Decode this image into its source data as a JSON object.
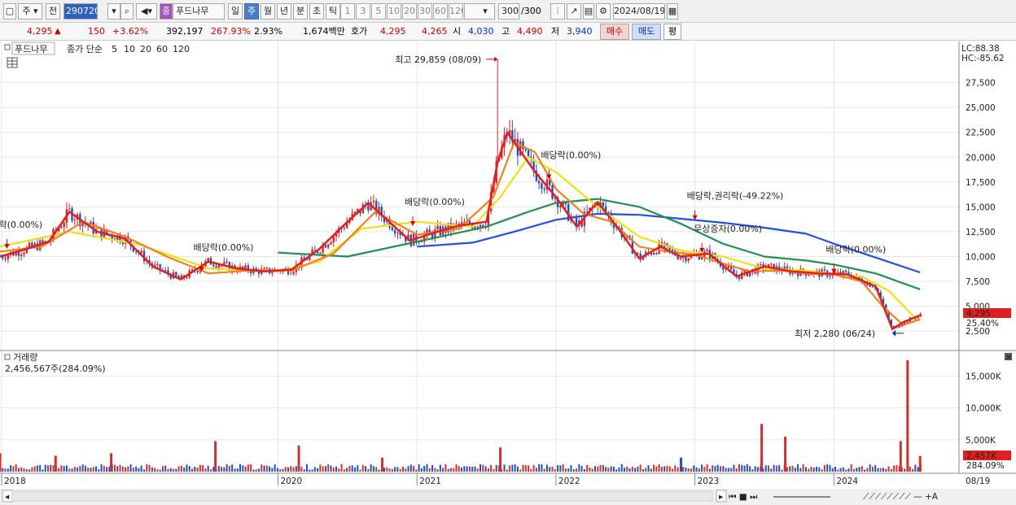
{
  "toolbar": {
    "period_type": "주",
    "prev_label": "전",
    "code_value": "290720",
    "name_badge": "종",
    "stock_name": "푸드나무",
    "period_tabs": [
      "일",
      "주",
      "월",
      "년",
      "분",
      "초",
      "틱"
    ],
    "selected_period": "주",
    "intervals": [
      "1",
      "3",
      "5",
      "10",
      "20",
      "30",
      "60",
      "120"
    ],
    "count": "300",
    "count_total": "/300",
    "date": "2024/08/19"
  },
  "quote": {
    "price": "4,295",
    "change_arrow": "▲",
    "change": "150",
    "change_pct": "+3.62%",
    "volume": "392,197",
    "volume_ratio": "267.93%",
    "turnover": "2.93%",
    "amount": "1,674백만",
    "ask_label": "호가",
    "ask": "4,295",
    "bid": "4,265",
    "open_label": "시",
    "open": "4,030",
    "high_label": "고",
    "high": "4,490",
    "low_label": "저",
    "low": "3,940",
    "buy_label": "매수",
    "sell_label": "매도",
    "eval_label": "평"
  },
  "legend": {
    "name": "푸드나무",
    "ma_label": "종가 단순",
    "periods": [
      "5",
      "10",
      "20",
      "60",
      "120"
    ],
    "colors": [
      "#e02020",
      "#f08020",
      "#f0e010",
      "#209050",
      "#2050e0"
    ]
  },
  "right_axis": {
    "lc": "LC:88.38",
    "hc": "HC:-85.62",
    "price_tag": "4,295",
    "pct_tag": "25.40%",
    "vol_tag": "2,457K",
    "vol_pct_tag": "284.09%"
  },
  "volume_panel": {
    "title": "거래량",
    "value": "2,456,567주(284.09%)"
  },
  "bottom": {
    "date_label": "08/19"
  },
  "chart_data": [
    {
      "type": "line",
      "ylim": [
        1200,
        30500
      ],
      "y_ticks": [
        2500,
        5000,
        7500,
        10000,
        12500,
        15000,
        17500,
        20000,
        22500,
        25000,
        27500
      ],
      "y_tick_labels": [
        "2,500",
        "5,000",
        "7,500",
        "10,000",
        "12,500",
        "15,000",
        "17,500",
        "20,000",
        "22,500",
        "25,000",
        "27,500"
      ],
      "x_ticks": [
        2018,
        2020,
        2021,
        2022,
        2023,
        2024
      ],
      "x_tick_labels": [
        "2018",
        "2020",
        "2021",
        "2022",
        "2023",
        "2024"
      ],
      "x_range": [
        2018.0,
        2024.9
      ],
      "series": [
        {
          "name": "5",
          "color": "#e02020",
          "x": [
            2018.0,
            2018.2,
            2018.35,
            2018.5,
            2018.7,
            2018.9,
            2019.1,
            2019.3,
            2019.5,
            2019.7,
            2019.9,
            2020.1,
            2020.3,
            2020.5,
            2020.65,
            2020.8,
            2020.95,
            2021.1,
            2021.3,
            2021.5,
            2021.58,
            2021.65,
            2021.75,
            2021.85,
            2022.0,
            2022.15,
            2022.3,
            2022.45,
            2022.6,
            2022.75,
            2022.9,
            2023.1,
            2023.3,
            2023.5,
            2023.7,
            2023.9,
            2024.1,
            2024.3,
            2024.42,
            2024.5,
            2024.62
          ],
          "y": [
            10000,
            10800,
            11500,
            14500,
            12500,
            11800,
            9000,
            7700,
            9500,
            8800,
            8500,
            8700,
            10800,
            13500,
            15400,
            13500,
            11600,
            12300,
            13100,
            13500,
            19500,
            22500,
            20500,
            18500,
            16000,
            13000,
            15500,
            12800,
            9800,
            11000,
            10000,
            10300,
            8000,
            9000,
            8500,
            8300,
            8200,
            7000,
            2700,
            3400,
            4100
          ]
        },
        {
          "name": "10",
          "color": "#f08020",
          "x": [
            2018.0,
            2018.3,
            2018.6,
            2018.9,
            2019.2,
            2019.5,
            2019.8,
            2020.1,
            2020.4,
            2020.7,
            2021.0,
            2021.3,
            2021.55,
            2021.7,
            2021.85,
            2022.0,
            2022.2,
            2022.4,
            2022.6,
            2022.8,
            2023.0,
            2023.2,
            2023.4,
            2023.6,
            2023.8,
            2024.0,
            2024.2,
            2024.35,
            2024.5,
            2024.62
          ],
          "y": [
            10500,
            11000,
            13500,
            12000,
            10000,
            8300,
            8600,
            8600,
            10300,
            14500,
            12200,
            12800,
            16000,
            21500,
            20500,
            16800,
            14300,
            13500,
            11000,
            10500,
            10200,
            9300,
            8500,
            8600,
            8300,
            8200,
            7500,
            5000,
            3100,
            3700
          ]
        },
        {
          "name": "20",
          "color": "#f0e010",
          "x": [
            2018.0,
            2018.5,
            2019.0,
            2019.5,
            2020.0,
            2020.3,
            2020.6,
            2021.0,
            2021.4,
            2021.6,
            2021.8,
            2022.0,
            2022.3,
            2022.6,
            2022.9,
            2023.2,
            2023.5,
            2023.8,
            2024.0,
            2024.2,
            2024.4,
            2024.55,
            2024.62
          ],
          "y": [
            11000,
            12500,
            11200,
            8800,
            8500,
            9500,
            12800,
            13500,
            13000,
            16000,
            20000,
            18500,
            15000,
            12000,
            10600,
            10000,
            8800,
            8600,
            8200,
            8000,
            6500,
            4300,
            3500
          ]
        },
        {
          "name": "60",
          "color": "#209050",
          "x": [
            2020.0,
            2020.5,
            2021.0,
            2021.5,
            2021.8,
            2022.0,
            2022.3,
            2022.6,
            2022.9,
            2023.2,
            2023.5,
            2023.8,
            2024.0,
            2024.3,
            2024.62
          ],
          "y": [
            10400,
            10000,
            11500,
            13000,
            14500,
            15400,
            15800,
            15000,
            13300,
            11300,
            10000,
            9600,
            9200,
            8300,
            6700
          ]
        },
        {
          "name": "120",
          "color": "#2050e0",
          "x": [
            2021.0,
            2021.4,
            2021.7,
            2022.0,
            2022.3,
            2022.6,
            2022.9,
            2023.2,
            2023.5,
            2023.8,
            2024.0,
            2024.3,
            2024.62
          ],
          "y": [
            11000,
            11400,
            12500,
            13700,
            14300,
            14200,
            13800,
            13400,
            12900,
            12300,
            11300,
            9900,
            8400
          ]
        }
      ],
      "annotations": [
        {
          "text": "최고 29,859 (08/09)",
          "x": 2021.58,
          "y": 29859,
          "color": "#d00000"
        },
        {
          "text": "최저 2,280 (06/24)",
          "x": 2024.42,
          "y": 2280,
          "color": "#0030a0"
        },
        {
          "text": "락(0.00%)",
          "x": 2018.05,
          "y": 12900
        },
        {
          "text": "배당락(0.00%)",
          "x": 2019.45,
          "y": 10600
        },
        {
          "text": "배당락(0.00%)",
          "x": 2020.97,
          "y": 15200
        },
        {
          "text": "배당락(0.00%)",
          "x": 2021.95,
          "y": 19900
        },
        {
          "text": "배당락,권리락(-49.22%)",
          "x": 2023.0,
          "y": 15800
        },
        {
          "text": "무상증자(0.00%)",
          "x": 2023.05,
          "y": 12500
        },
        {
          "text": "배당락(0.00%)",
          "x": 2024.0,
          "y": 10400
        }
      ]
    },
    {
      "type": "bar",
      "title": "거래량",
      "ylim": [
        0,
        18000
      ],
      "y_ticks": [
        5000,
        10000,
        15000
      ],
      "y_tick_labels": [
        "5,000K",
        "10,000K",
        "15,000K"
      ],
      "spikes": [
        {
          "x": 2018.0,
          "value": 2900,
          "color": "#d03030"
        },
        {
          "x": 2018.4,
          "value": 2500,
          "color": "#d03030"
        },
        {
          "x": 2018.8,
          "value": 2900,
          "color": "#d03030"
        },
        {
          "x": 2019.55,
          "value": 4800,
          "color": "#d03030"
        },
        {
          "x": 2020.15,
          "value": 4100,
          "color": "#d03030"
        },
        {
          "x": 2020.75,
          "value": 2200,
          "color": "#d03030"
        },
        {
          "x": 2021.6,
          "value": 3800,
          "color": "#d03030"
        },
        {
          "x": 2022.9,
          "value": 2200,
          "color": "#2050c0"
        },
        {
          "x": 2023.48,
          "value": 7500,
          "color": "#d03030"
        },
        {
          "x": 2023.65,
          "value": 5500,
          "color": "#d03030"
        },
        {
          "x": 2024.48,
          "value": 4800,
          "color": "#d03030"
        },
        {
          "x": 2024.53,
          "value": 17500,
          "color": "#d03030"
        },
        {
          "x": 2024.62,
          "value": 2457,
          "color": "#d03030"
        }
      ]
    }
  ]
}
